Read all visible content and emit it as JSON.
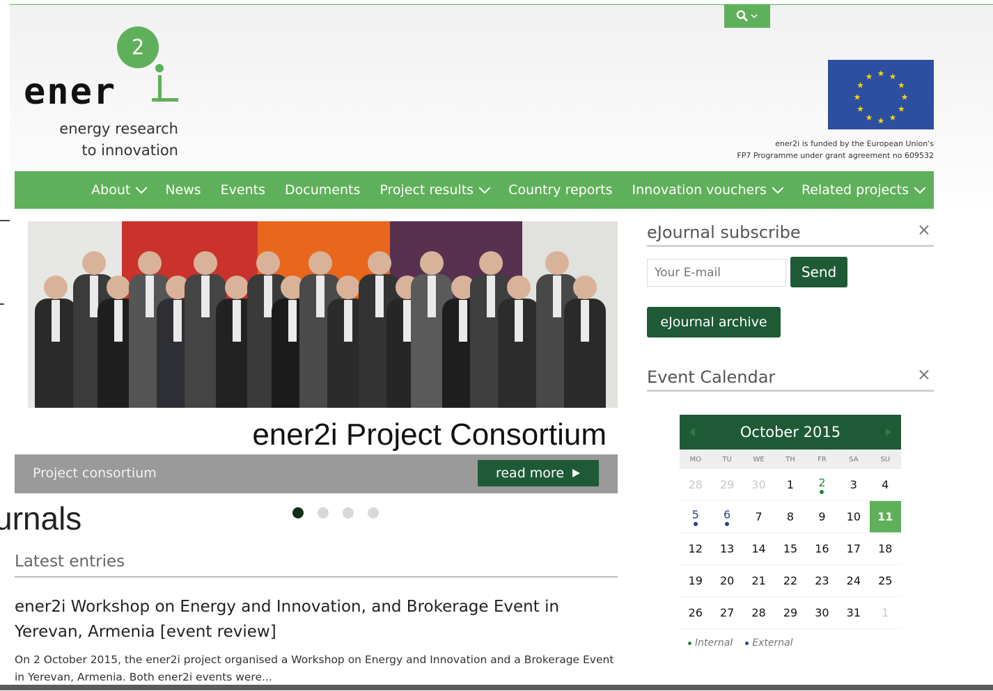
{
  "search": {
    "icon": "search-icon"
  },
  "logo": {
    "word": "ener",
    "number": "2",
    "tagline_1": "energy research",
    "tagline_2": "to innovation"
  },
  "funding": {
    "line_1": "ener2i is funded by the European Union's",
    "line_2": "FP7 Programme under grant agreement no 609532"
  },
  "nav": {
    "items": [
      {
        "label": "About",
        "dropdown": true
      },
      {
        "label": "News",
        "dropdown": false
      },
      {
        "label": "Events",
        "dropdown": false
      },
      {
        "label": "Documents",
        "dropdown": false
      },
      {
        "label": "Project results",
        "dropdown": true
      },
      {
        "label": "Country reports",
        "dropdown": false
      },
      {
        "label": "Innovation vouchers",
        "dropdown": true
      },
      {
        "label": "Related projects",
        "dropdown": true
      }
    ]
  },
  "slider": {
    "title": "ener2i Project Consortium",
    "caption": "Project consortium",
    "read_more": "read more",
    "slide_count": 4,
    "active_slide": 1,
    "edge_text": "urnals"
  },
  "latest": {
    "heading": "Latest entries",
    "entry_title": "ener2i Workshop on Energy and Innovation, and Brokerage Event in Yerevan, Armenia [event review]",
    "entry_body": "On 2 October 2015, the ener2i project organised a Workshop on Energy and Innovation and a Brokerage Event in Yerevan, Armenia. Both ener2i events were..."
  },
  "subscribe": {
    "heading": "eJournal subscribe",
    "email_placeholder": "Your E-mail",
    "send": "Send",
    "archive": "eJournal archive"
  },
  "calendar": {
    "heading": "Event Calendar",
    "month": "October 2015",
    "weekdays": [
      "MO",
      "TU",
      "WE",
      "TH",
      "FR",
      "SA",
      "SU"
    ],
    "days": [
      {
        "d": "28",
        "state": "muted"
      },
      {
        "d": "29",
        "state": "muted"
      },
      {
        "d": "30",
        "state": "muted"
      },
      {
        "d": "1",
        "state": ""
      },
      {
        "d": "2",
        "state": "internal"
      },
      {
        "d": "3",
        "state": ""
      },
      {
        "d": "4",
        "state": ""
      },
      {
        "d": "5",
        "state": "external"
      },
      {
        "d": "6",
        "state": "external"
      },
      {
        "d": "7",
        "state": ""
      },
      {
        "d": "8",
        "state": ""
      },
      {
        "d": "9",
        "state": ""
      },
      {
        "d": "10",
        "state": ""
      },
      {
        "d": "11",
        "state": "today"
      },
      {
        "d": "12",
        "state": ""
      },
      {
        "d": "13",
        "state": ""
      },
      {
        "d": "14",
        "state": ""
      },
      {
        "d": "15",
        "state": ""
      },
      {
        "d": "16",
        "state": ""
      },
      {
        "d": "17",
        "state": ""
      },
      {
        "d": "18",
        "state": ""
      },
      {
        "d": "19",
        "state": ""
      },
      {
        "d": "20",
        "state": ""
      },
      {
        "d": "21",
        "state": ""
      },
      {
        "d": "22",
        "state": ""
      },
      {
        "d": "23",
        "state": ""
      },
      {
        "d": "24",
        "state": ""
      },
      {
        "d": "25",
        "state": ""
      },
      {
        "d": "26",
        "state": ""
      },
      {
        "d": "27",
        "state": ""
      },
      {
        "d": "28",
        "state": ""
      },
      {
        "d": "29",
        "state": ""
      },
      {
        "d": "30",
        "state": ""
      },
      {
        "d": "31",
        "state": ""
      },
      {
        "d": "1",
        "state": "muted"
      }
    ],
    "legend_internal": "Internal",
    "legend_external": "External",
    "colors": {
      "internal": "#1d8a36",
      "external": "#23419a"
    }
  },
  "colors": {
    "brand_green": "#5fb05a",
    "dark_green": "#1f5a36",
    "eu_blue": "#2d4fa0"
  }
}
